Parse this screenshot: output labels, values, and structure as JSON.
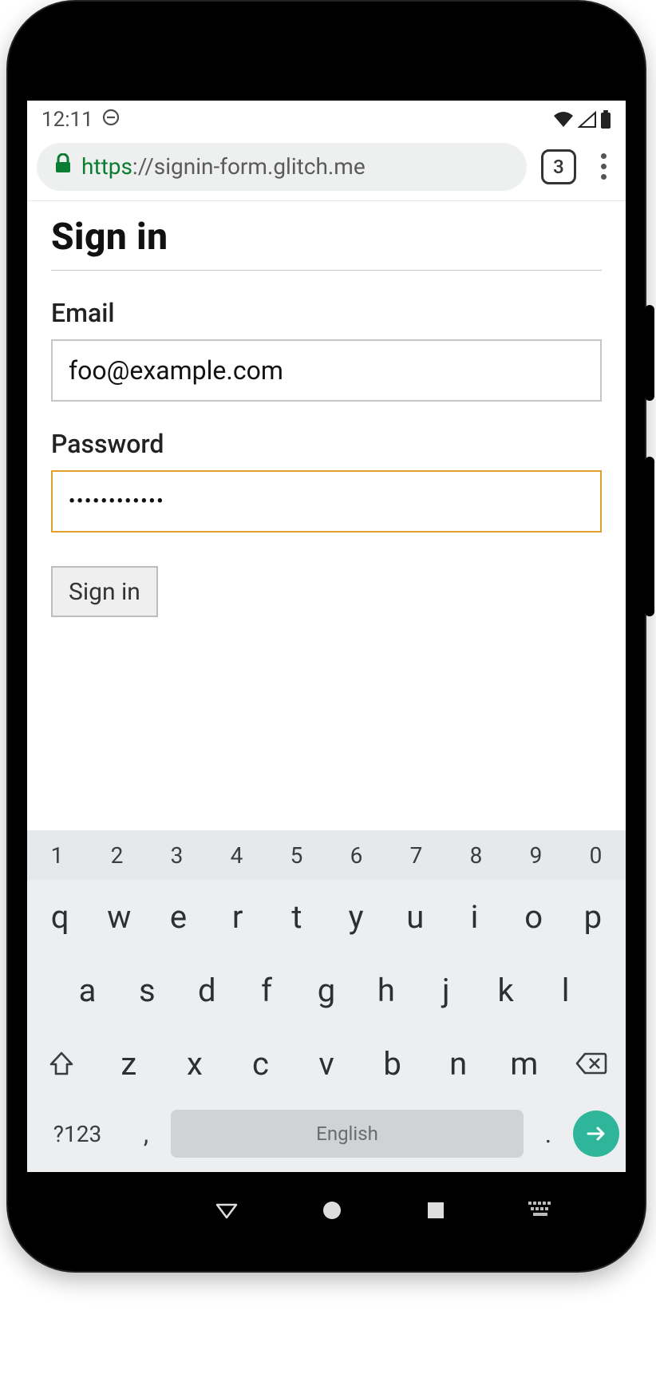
{
  "status": {
    "time": "12:11",
    "icons": {
      "dnd": "dnd-icon",
      "wifi": "wifi-icon",
      "cell": "cell-icon",
      "battery": "battery-icon"
    }
  },
  "browser": {
    "lock": true,
    "url_scheme": "https",
    "url_sep": "://",
    "url_host": "signin-form.glitch.me",
    "tab_count": "3"
  },
  "page": {
    "title": "Sign in",
    "email_label": "Email",
    "email_value": "foo@example.com",
    "password_label": "Password",
    "password_masked": "••••••••••••",
    "submit_label": "Sign in"
  },
  "keyboard": {
    "numbers": [
      "1",
      "2",
      "3",
      "4",
      "5",
      "6",
      "7",
      "8",
      "9",
      "0"
    ],
    "row1": [
      "q",
      "w",
      "e",
      "r",
      "t",
      "y",
      "u",
      "i",
      "o",
      "p"
    ],
    "row2": [
      "a",
      "s",
      "d",
      "f",
      "g",
      "h",
      "j",
      "k",
      "l"
    ],
    "row3": [
      "z",
      "x",
      "c",
      "v",
      "b",
      "n",
      "m"
    ],
    "symbols_label": "?123",
    "space_label": "English",
    "comma": ",",
    "period": "."
  }
}
